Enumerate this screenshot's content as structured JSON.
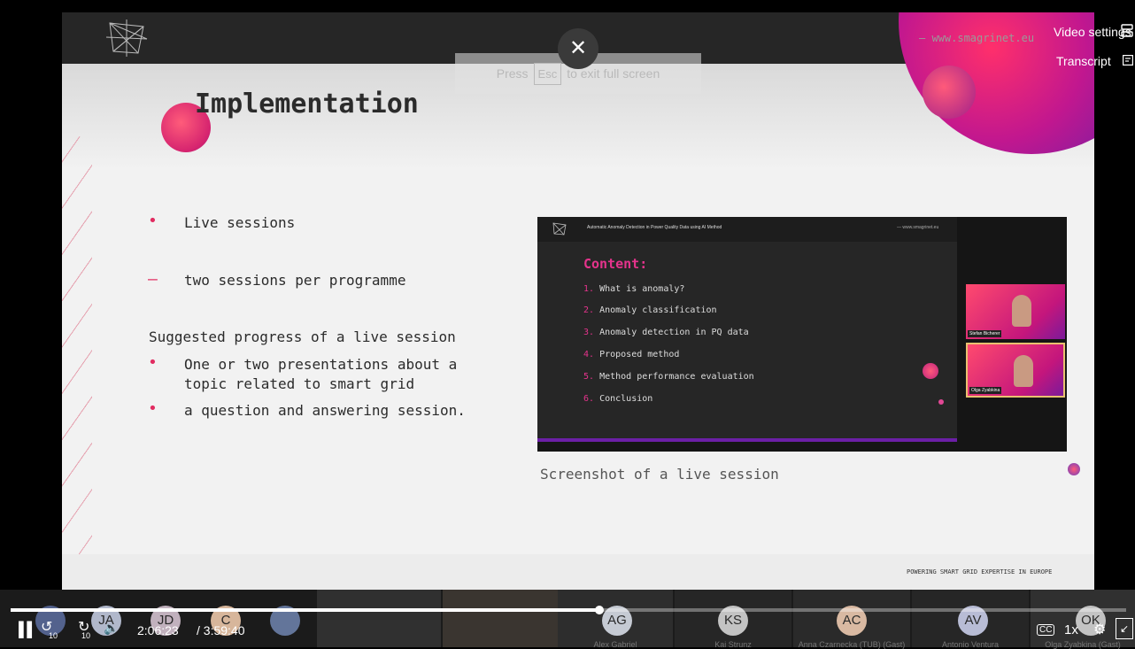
{
  "slide": {
    "title": "Implementation",
    "site_url": "— www.smagrinet.eu",
    "bullets": {
      "b1_marker": "•",
      "b1": "Live sessions",
      "b2_marker": "–",
      "b2": "two sessions per programme",
      "heading": "Suggested progress of a live session",
      "b3_marker": "•",
      "b3_line1": "One or two presentations about a",
      "b3_line2": "topic related to smart grid",
      "b4_marker": "•",
      "b4": "a question and answering session."
    },
    "caption": "Screenshot of a live session",
    "footer": "POWERING SMART GRID EXPERTISE IN EUROPE",
    "embedded": {
      "header": "Automatic Anomaly Detection in Power Quality Data using AI Method",
      "url": "— www.smagrinet.eu",
      "content_title": "Content:",
      "items": [
        {
          "num": "1.",
          "text": "What is anomaly?"
        },
        {
          "num": "2.",
          "text": "Anomaly classification"
        },
        {
          "num": "3.",
          "text": "Anomaly detection in PQ data"
        },
        {
          "num": "4.",
          "text": "Proposed method"
        },
        {
          "num": "5.",
          "text": "Method performance evaluation"
        },
        {
          "num": "6.",
          "text": "Conclusion"
        }
      ],
      "cam1_name": "Stefan Bicherer",
      "cam2_name": "Olga Zyabkina"
    }
  },
  "overlay": {
    "esc_press": "Press",
    "esc_key": "Esc",
    "esc_tail": "to exit full screen",
    "close_glyph": "✕",
    "video_settings": "Video settings",
    "transcript": "Transcript"
  },
  "participants": {
    "avatars": [
      "JA",
      "JD",
      "C",
      "AG",
      "KS",
      "AC",
      "AV",
      "OK"
    ],
    "names": [
      "Alex Gabriel",
      "Kai Strunz",
      "Anna Czarnecka (TUB) (Gast)",
      "Antonio Ventura",
      "Olga Zyabkina (Gast)"
    ]
  },
  "controls": {
    "play_glyph": "▌▌",
    "skip_back_glyph": "↺",
    "skip_back_seconds": "10",
    "skip_fwd_glyph": "↻",
    "skip_fwd_seconds": "10",
    "volume_glyph": "🔈",
    "time_current": "2:06:23",
    "time_total": "/ 3:59:40",
    "progress_fraction": 0.5275,
    "cc": "CC",
    "speed": "1x",
    "settings_glyph": "⚙",
    "exit_fullscreen_glyph": "↙"
  },
  "colors": {
    "accent_pink": "#e12c61",
    "accent_purple": "#6b1fa6",
    "avatar_colors": [
      "#8a93b8",
      "#c2c9df",
      "#d3c2cf",
      "#ecc7a9",
      "#d6dbe6",
      "#d4d4d4",
      "#ecc9af",
      "#c8cde8",
      "#d4d4d4"
    ]
  }
}
